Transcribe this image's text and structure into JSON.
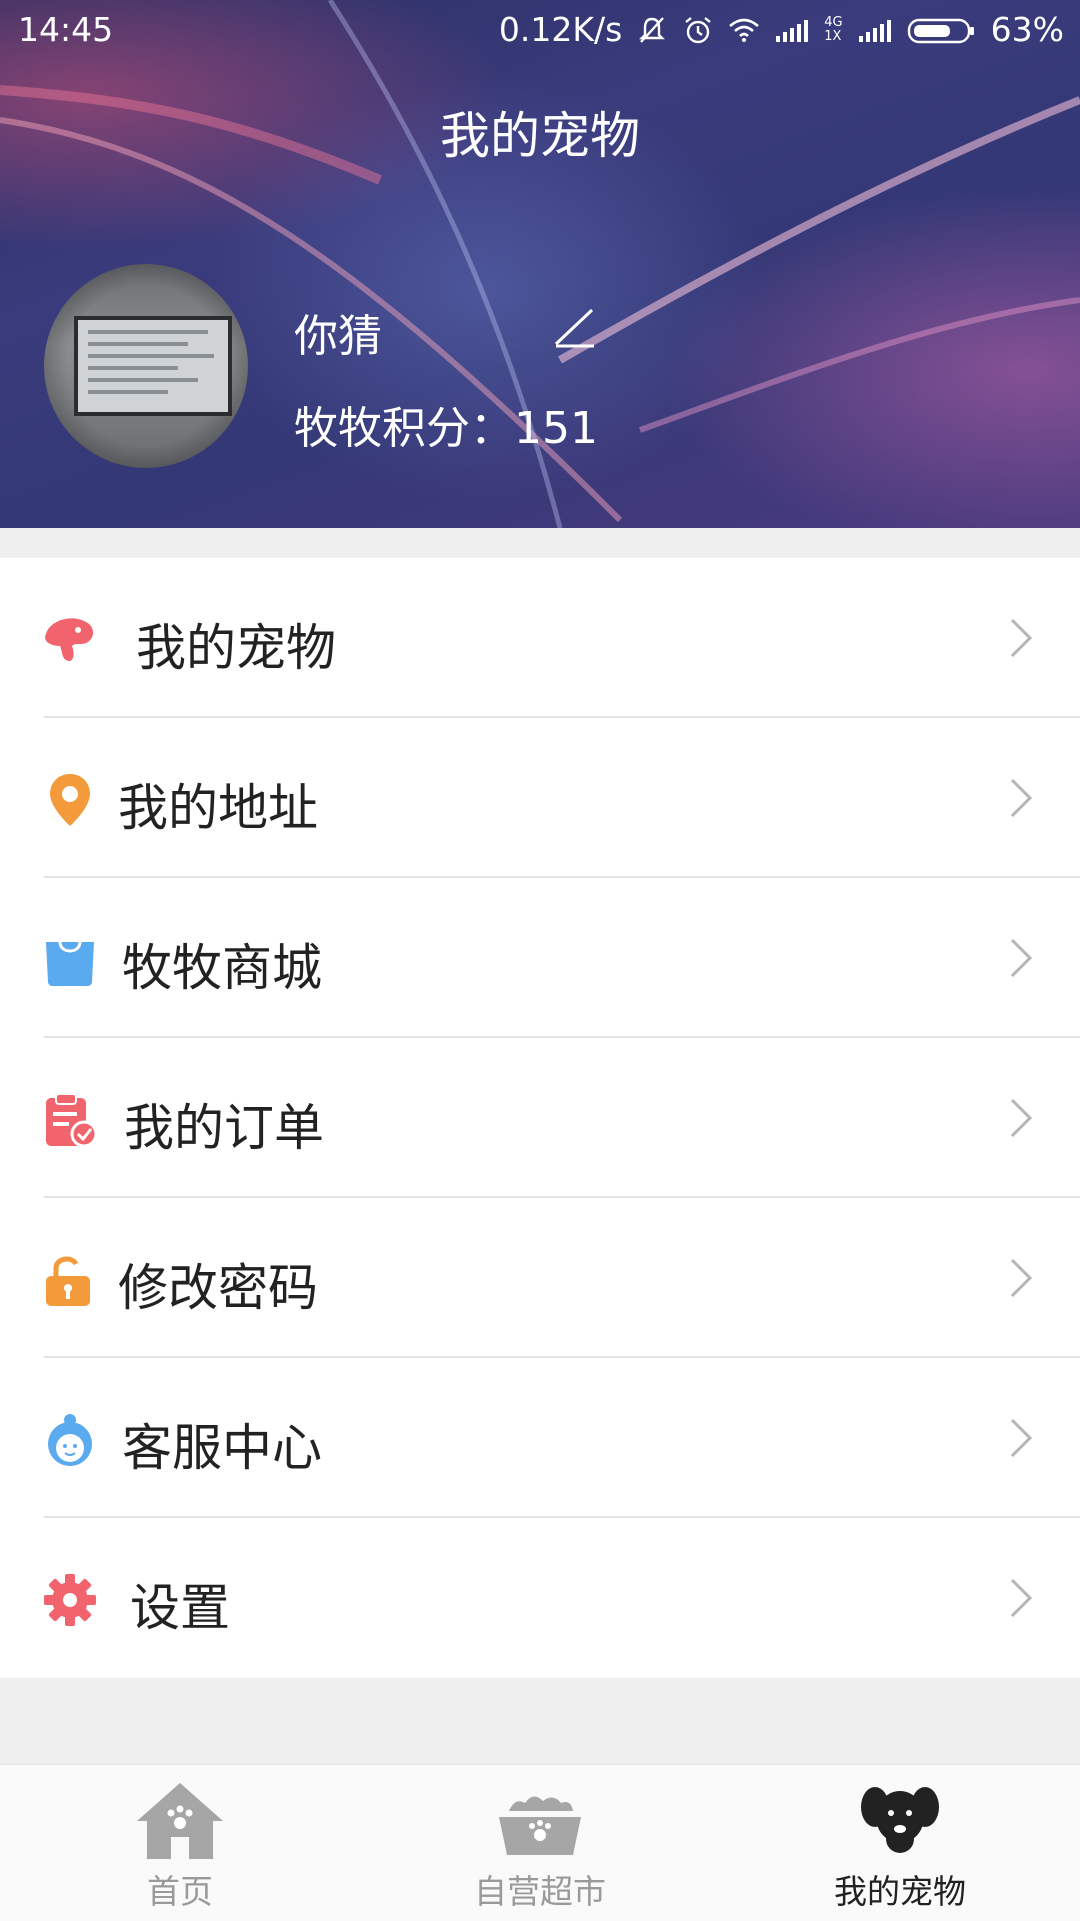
{
  "status_bar": {
    "time": "14:45",
    "network_speed": "0.12K/s",
    "net_4g": "4G",
    "net_1x": "1X",
    "battery": "63%"
  },
  "header": {
    "title": "我的宠物",
    "username": "你猜",
    "points_label": "牧牧积分：",
    "points_value": "151"
  },
  "menu": {
    "items": [
      {
        "label": "我的宠物",
        "icon": "pet-dog-icon",
        "color": "#f2646d"
      },
      {
        "label": "我的地址",
        "icon": "location-pin-icon",
        "color": "#f39a3a"
      },
      {
        "label": "牧牧商城",
        "icon": "shopping-bag-icon",
        "color": "#5aaaf0"
      },
      {
        "label": "我的订单",
        "icon": "order-clipboard-icon",
        "color": "#f2646d"
      },
      {
        "label": "修改密码",
        "icon": "unlock-icon",
        "color": "#f39a3a"
      },
      {
        "label": "客服中心",
        "icon": "customer-service-icon",
        "color": "#5aaaf0"
      },
      {
        "label": "设置",
        "icon": "gear-icon",
        "color": "#f2646d"
      }
    ]
  },
  "tabbar": {
    "tabs": [
      {
        "label": "首页",
        "icon": "home-paw-icon",
        "active": false
      },
      {
        "label": "自营超市",
        "icon": "pet-bowl-icon",
        "active": false
      },
      {
        "label": "我的宠物",
        "icon": "dog-face-icon",
        "active": true
      }
    ]
  },
  "colors": {
    "header_bg": "#343876",
    "accent_red": "#f2646d",
    "accent_orange": "#f39a3a",
    "accent_blue": "#5aaaf0",
    "tab_active": "#222222",
    "tab_inactive": "#9a9a9a"
  }
}
